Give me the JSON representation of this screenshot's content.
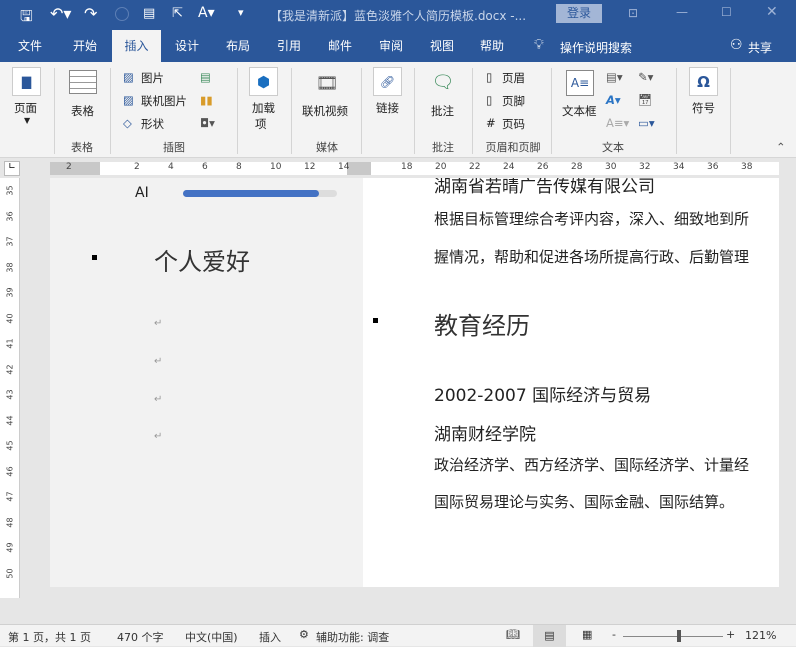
{
  "titlebar": {
    "doc_title": "【我是清新派】蓝色淡雅个人简历模板.docx  -...",
    "login": "登录"
  },
  "tabs": [
    "文件",
    "开始",
    "插入",
    "设计",
    "布局",
    "引用",
    "邮件",
    "审阅",
    "视图",
    "帮助"
  ],
  "tell_me": "操作说明搜索",
  "share": "共享",
  "ribbon": {
    "page": "页面",
    "table": "表格",
    "picture": "图片",
    "online_picture": "联机图片",
    "shapes": "形状",
    "addins_1": "加载",
    "addins_2": "项",
    "online_video": "联机视频",
    "link": "链接",
    "comment": "批注",
    "header": "页眉",
    "footer": "页脚",
    "page_number": "页码",
    "textbox": "文本框",
    "symbol": "符号",
    "groups": {
      "table": "表格",
      "illustrations": "插图",
      "media": "媒体",
      "comments": "批注",
      "header_footer": "页眉和页脚",
      "text": "文本"
    }
  },
  "ruler": {
    "h": [
      "2",
      "2",
      "4",
      "6",
      "8",
      "10",
      "12",
      "14",
      "18",
      "20",
      "22",
      "24",
      "26",
      "28",
      "30",
      "32",
      "34",
      "36",
      "38"
    ],
    "v": [
      "35",
      "36",
      "37",
      "38",
      "39",
      "40",
      "41",
      "42",
      "43",
      "44",
      "45",
      "46",
      "47",
      "48",
      "49",
      "50"
    ]
  },
  "doc": {
    "skill_label": "AI",
    "skill_level_percent": 88,
    "hobbies_heading": "个人爱好",
    "company": "湖南省若晴广告传媒有限公司",
    "job_line1": "根据目标管理综合考评内容，深入、细致地到所",
    "job_line2": "握情况，帮助和促进各场所提高行政、后勤管理",
    "edu_heading": "教育经历",
    "edu_period": "2002-2007 国际经济与贸易",
    "school": "湖南财经学院",
    "courses1": "政治经济学、西方经济学、国际经济学、计量经",
    "courses2": "国际贸易理论与实务、国际金融、国际结算。"
  },
  "status": {
    "page": "第 1 页，共 1 页",
    "words": "470 个字",
    "lang": "中文(中国)",
    "mode": "插入",
    "accessibility": "辅助功能: 调查",
    "zoom": "121%",
    "zoom_level_percent": 121
  },
  "colors": {
    "brand": "#2b579a",
    "heading_blue": "#4a7ebb"
  }
}
